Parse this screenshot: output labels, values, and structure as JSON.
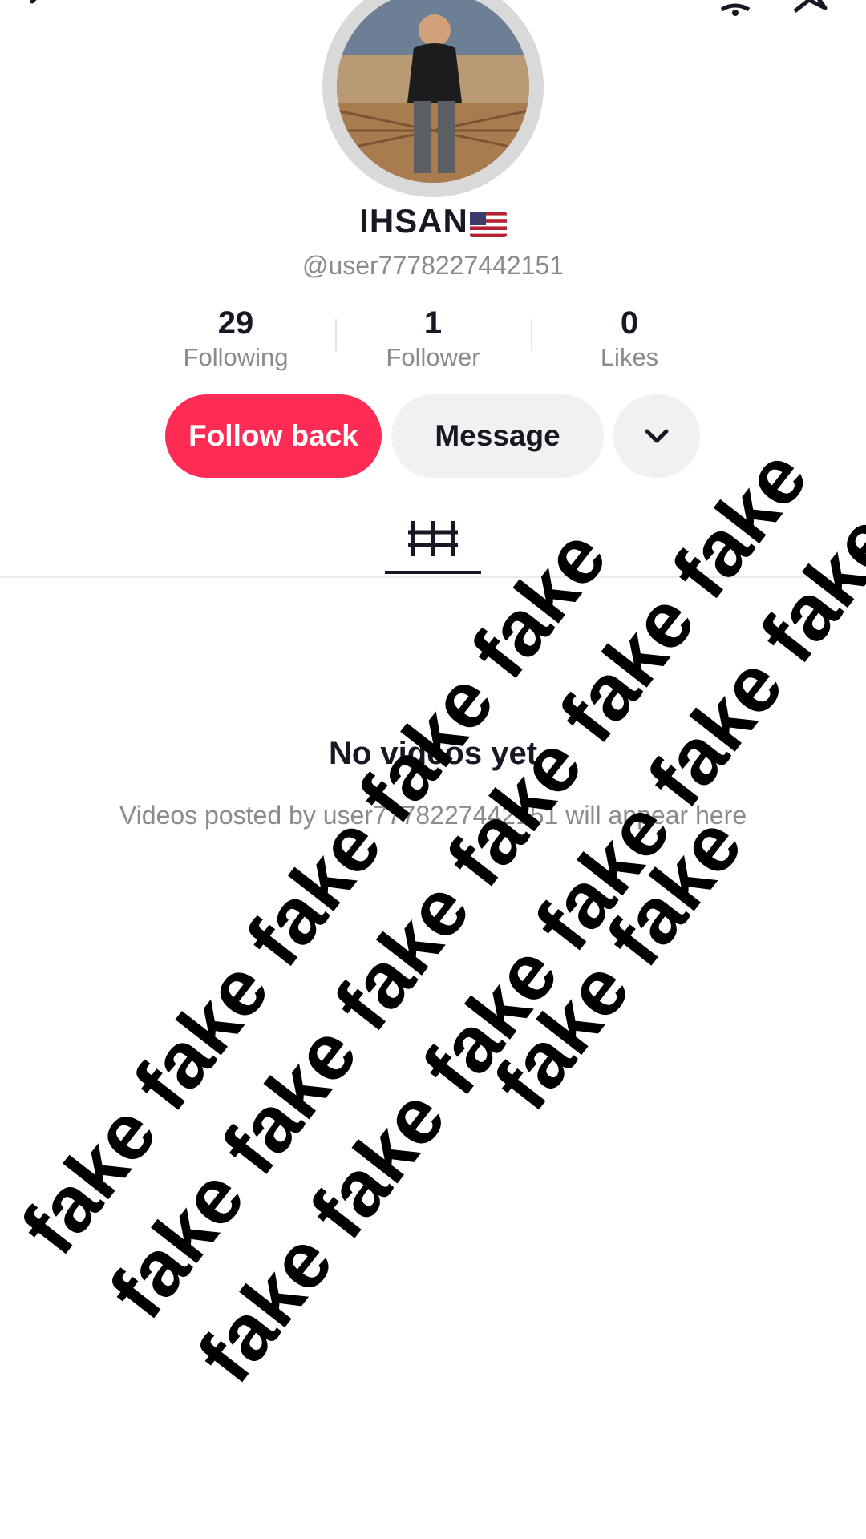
{
  "profile": {
    "display_name": "IHSAN",
    "handle": "@user7778227442151"
  },
  "stats": {
    "following": {
      "count": "29",
      "label": "Following"
    },
    "followers": {
      "count": "1",
      "label": "Follower"
    },
    "likes": {
      "count": "0",
      "label": "Likes"
    }
  },
  "actions": {
    "follow_back": "Follow back",
    "message": "Message"
  },
  "empty_state": {
    "title": "No videos yet",
    "subtitle": "Videos posted by user7778227442151 will appear here"
  },
  "watermark": {
    "line_1": "fake fake fake fake fake",
    "line_2": "fake fake fake fake fake fake",
    "line_3": "fake fake fake fake fake fake",
    "line_4": "fake fake"
  },
  "colors": {
    "follow_button": "#fe2c55",
    "message_button": "#f1f1f2",
    "secondary_text": "#8a8b91"
  },
  "icons": [
    "back-icon",
    "bell-icon",
    "share-icon",
    "grid-icon",
    "chevron-down-icon",
    "flag-us-icon"
  ]
}
